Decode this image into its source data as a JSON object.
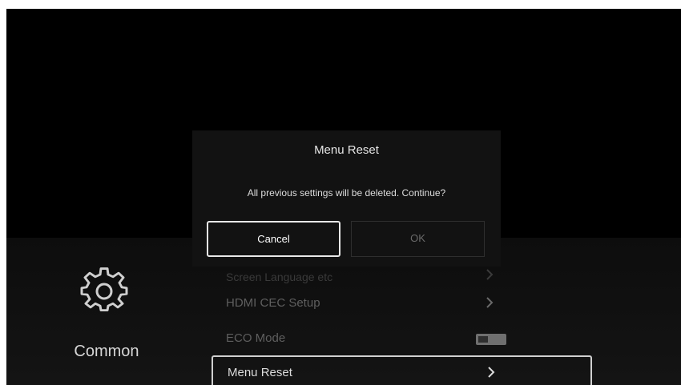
{
  "dialog": {
    "title": "Menu Reset",
    "message": "All previous settings will be deleted. Continue?",
    "cancel_label": "Cancel",
    "ok_label": "OK",
    "focused_button": "Cancel"
  },
  "sidebar": {
    "category_icon": "gear-icon",
    "category_label": "Common"
  },
  "menu": {
    "items": [
      {
        "label": "Screen Language etc",
        "icon": "chevron-right-icon",
        "state": "partially-hidden"
      },
      {
        "label": "HDMI CEC Setup",
        "icon": "chevron-right-icon"
      },
      {
        "label": "ECO Mode",
        "icon": "toggle-switch",
        "toggle_on": false
      },
      {
        "label": "Menu Reset",
        "icon": "chevron-right-icon",
        "focused": true
      }
    ]
  },
  "colors": {
    "background": "#000000",
    "dialog_background": "#121212",
    "focus_border": "#e8e8e8",
    "dim_text": "#5f5f5f"
  }
}
